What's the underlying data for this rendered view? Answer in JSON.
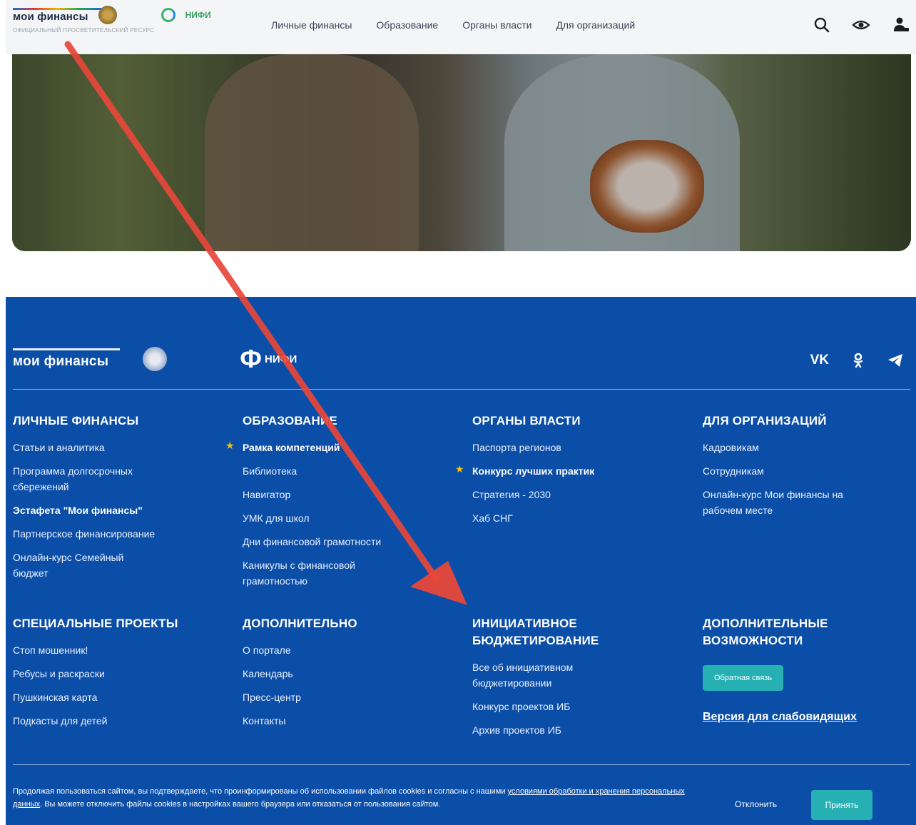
{
  "header": {
    "logo_text": "мои финансы",
    "logo_subtitle": "ОФИЦИАЛЬНЫЙ ПРОСВЕТИТЕЛЬСКИЙ РЕСУРС",
    "nifi_text": "НИФИ",
    "nav": [
      "Личные финансы",
      "Образование",
      "Органы власти",
      "Для организаций"
    ],
    "icons": [
      "search-icon",
      "eye-icon",
      "user-icon"
    ]
  },
  "footer": {
    "logo_text": "мои финансы",
    "nifi_text": "НИФИ",
    "social": [
      "VK",
      "OK",
      "Telegram"
    ],
    "sections": [
      {
        "title": "ЛИЧНЫЕ ФИНАНСЫ",
        "links": [
          {
            "label": "Статьи и аналитика",
            "bold": false,
            "star": false
          },
          {
            "label": "Программа долгосрочных сбережений",
            "bold": false,
            "star": false
          },
          {
            "label": "Эстафета \"Мои финансы\"",
            "bold": true,
            "star": false
          },
          {
            "label": "Партнерское финансирование",
            "bold": false,
            "star": false
          },
          {
            "label": "Онлайн-курс Семейный бюджет",
            "bold": false,
            "star": false
          }
        ]
      },
      {
        "title": "ОБРАЗОВАНИЕ",
        "links": [
          {
            "label": "Рамка компетенций",
            "bold": true,
            "star": true
          },
          {
            "label": "Библиотека",
            "bold": false,
            "star": false
          },
          {
            "label": "Навигатор",
            "bold": false,
            "star": false
          },
          {
            "label": "УМК для школ",
            "bold": false,
            "star": false
          },
          {
            "label": "Дни финансовой грамотности",
            "bold": false,
            "star": false
          },
          {
            "label": "Каникулы с финансовой грамотностью",
            "bold": false,
            "star": false
          }
        ]
      },
      {
        "title": "ОРГАНЫ ВЛАСТИ",
        "links": [
          {
            "label": "Паспорта регионов",
            "bold": false,
            "star": false
          },
          {
            "label": "Конкурс лучших практик",
            "bold": true,
            "star": true
          },
          {
            "label": "Стратегия - 2030",
            "bold": false,
            "star": false
          },
          {
            "label": "Хаб СНГ",
            "bold": false,
            "star": false
          }
        ]
      },
      {
        "title": "ДЛЯ ОРГАНИЗАЦИЙ",
        "links": [
          {
            "label": "Кадровикам",
            "bold": false,
            "star": false
          },
          {
            "label": "Сотрудникам",
            "bold": false,
            "star": false
          },
          {
            "label": "Онлайн-курс Мои финансы на рабочем месте",
            "bold": false,
            "star": false
          }
        ]
      },
      {
        "title": "СПЕЦИАЛЬНЫЕ ПРОЕКТЫ",
        "links": [
          {
            "label": "Стоп мошенник!",
            "bold": false,
            "star": false
          },
          {
            "label": "Ребусы и раскраски",
            "bold": false,
            "star": false
          },
          {
            "label": "Пушкинская карта",
            "bold": false,
            "star": false
          },
          {
            "label": "Подкасты для детей",
            "bold": false,
            "star": false
          }
        ]
      },
      {
        "title": "ДОПОЛНИТЕЛЬНО",
        "links": [
          {
            "label": "О портале",
            "bold": false,
            "star": false
          },
          {
            "label": "Календарь",
            "bold": false,
            "star": false
          },
          {
            "label": "Пресс-центр",
            "bold": false,
            "star": false
          },
          {
            "label": "Контакты",
            "bold": false,
            "star": false
          }
        ]
      },
      {
        "title": "ИНИЦИАТИВНОЕ БЮДЖЕТИРОВАНИЕ",
        "links": [
          {
            "label": "Все об инициативном бюджетировании",
            "bold": false,
            "star": false
          },
          {
            "label": "Конкурс проектов ИБ",
            "bold": false,
            "star": false
          },
          {
            "label": "Архив проектов ИБ",
            "bold": false,
            "star": false
          }
        ]
      },
      {
        "title": "ДОПОЛНИТЕЛЬНЫЕ ВОЗМОЖНОСТИ",
        "links": []
      }
    ],
    "feedback_button": "Обратная связь",
    "low_vision_link": "Версия для слабовидящих"
  },
  "cookie": {
    "text_before": "Продолжая пользоваться сайтом, вы подтверждаете, что проинформированы об использовании файлов cookies и согласны с нашими ",
    "link": "условиями обработки и хранения персональных данных",
    "text_after": ". Вы можете отключить файлы cookies в настройках вашего браузера или отказаться от пользования сайтом.",
    "decline": "Отклонить",
    "accept": "Принять"
  },
  "colors": {
    "footer_bg": "#0b4ea8",
    "accent_teal": "#27b0b4",
    "star": "#f4c20d",
    "annotation_arrow": "#e8473a"
  }
}
